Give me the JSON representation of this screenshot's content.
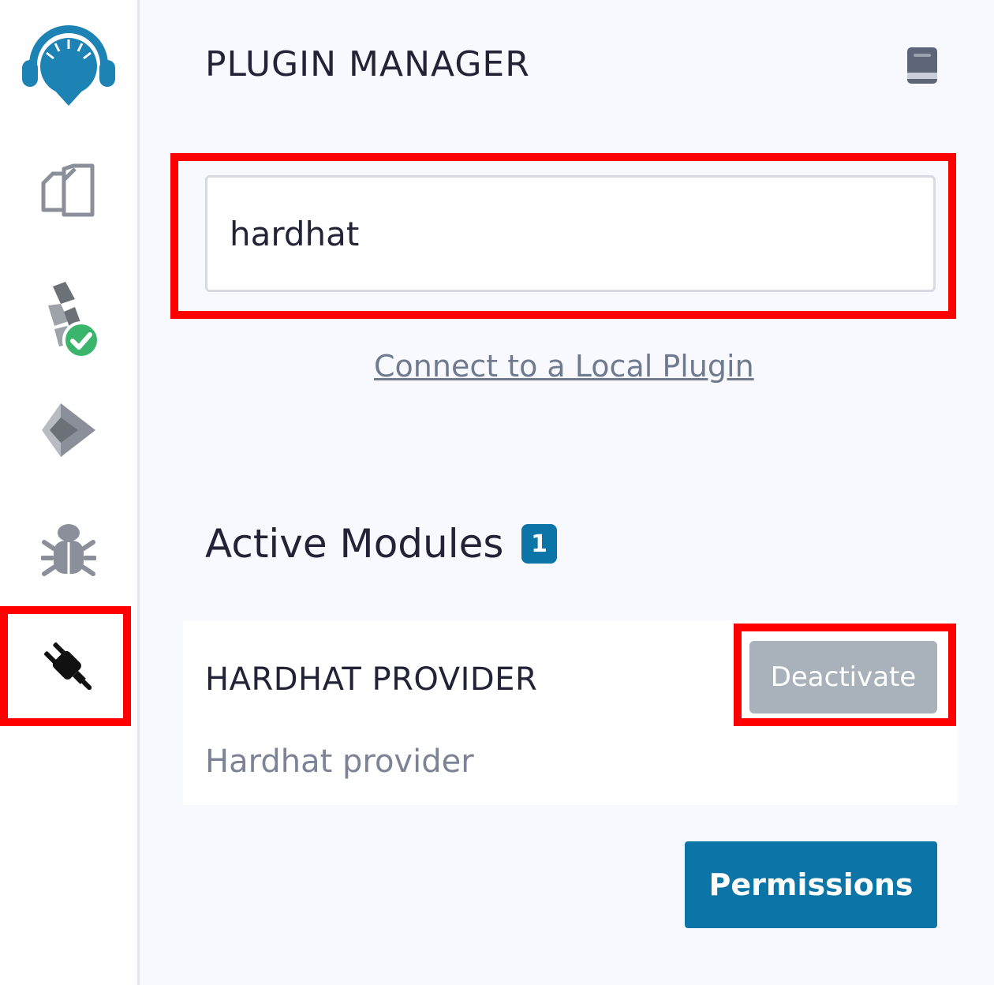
{
  "sidebar": {
    "icons": [
      {
        "name": "remix-logo-icon"
      },
      {
        "name": "file-explorer-icon"
      },
      {
        "name": "solidity-compiler-icon"
      },
      {
        "name": "deploy-run-icon"
      },
      {
        "name": "debugger-icon"
      },
      {
        "name": "plugin-manager-icon"
      }
    ]
  },
  "header": {
    "title": "PLUGIN MANAGER",
    "docs_icon": "book-icon"
  },
  "search": {
    "value": "hardhat"
  },
  "local_plugin_link": "Connect to a Local Plugin",
  "active_modules": {
    "label": "Active Modules",
    "count": "1",
    "items": [
      {
        "title": "HARDHAT PROVIDER",
        "description": "Hardhat provider",
        "button_label": "Deactivate"
      }
    ]
  },
  "permissions_label": "Permissions",
  "colors": {
    "accent": "#0a75a6",
    "highlight": "#ff0000",
    "disabled_button": "#a9b1bb"
  }
}
